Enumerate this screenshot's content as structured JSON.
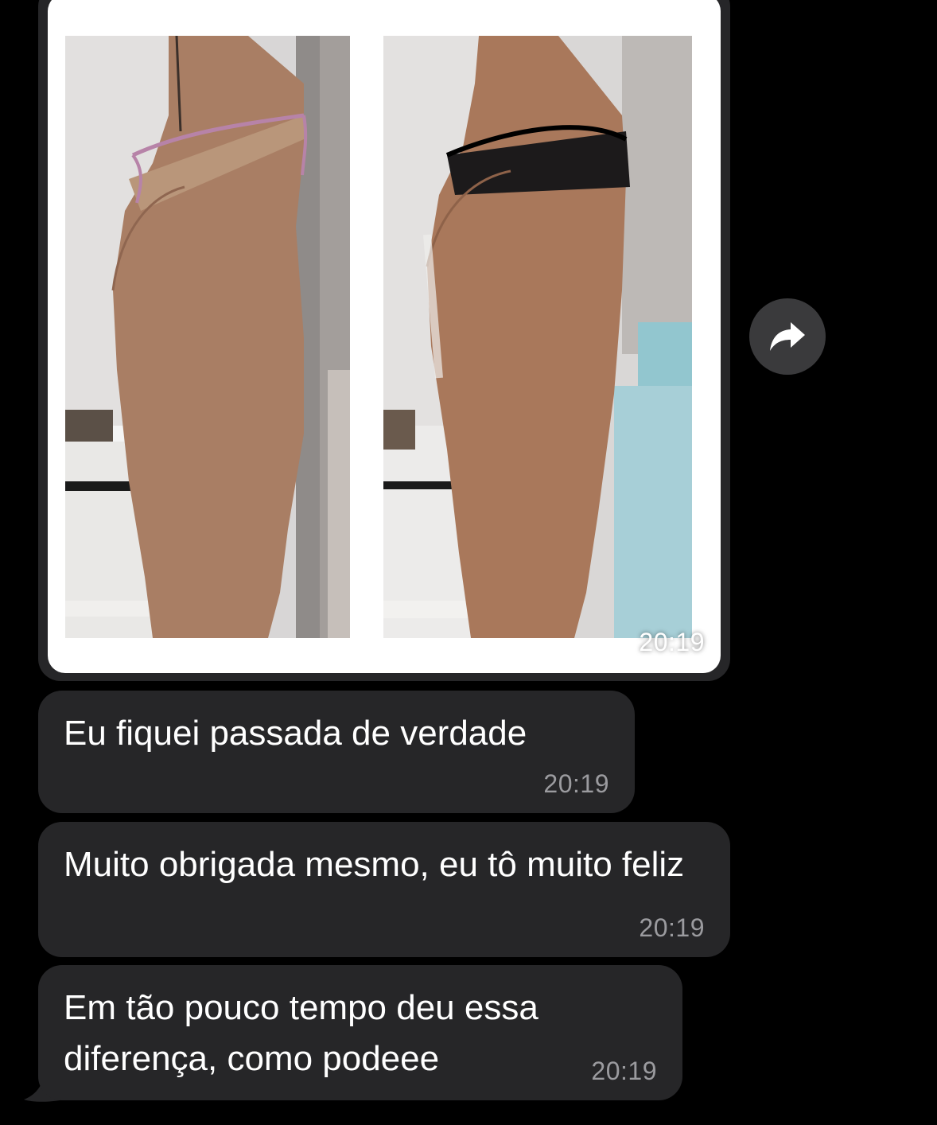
{
  "messages": [
    {
      "type": "image",
      "time": "20:19",
      "photos": [
        "before-photo",
        "after-photo"
      ]
    },
    {
      "type": "text",
      "text": "Eu fiquei passada de verdade",
      "time": "20:19"
    },
    {
      "type": "text",
      "text": "Muito obrigada mesmo, eu tô muito feliz",
      "time": "20:19"
    },
    {
      "type": "text",
      "text": "Em tão pouco tempo deu essa diferença, como podeee",
      "time": "20:19"
    }
  ],
  "icons": {
    "forward": "forward-arrow-icon"
  },
  "colors": {
    "background": "#000000",
    "bubble": "#262628",
    "text": "#ffffff",
    "timestamp": "#9b9b9f",
    "forward_button": "#3a3a3c"
  }
}
